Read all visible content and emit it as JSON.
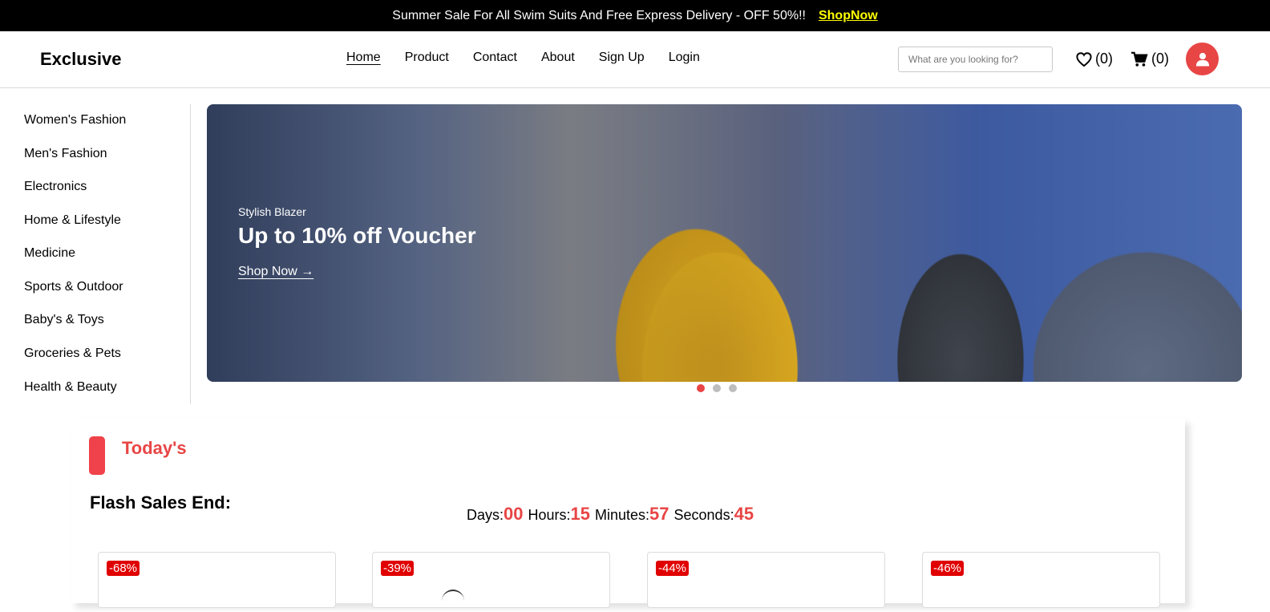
{
  "topbar": {
    "promo": "Summer Sale For All Swim Suits And Free Express Delivery - OFF 50%!!",
    "shop_now": "ShopNow"
  },
  "header": {
    "logo": "Exclusive",
    "nav": [
      "Home",
      "Product",
      "Contact",
      "About",
      "Sign Up",
      "Login"
    ],
    "active_nav": "Home",
    "search_placeholder": "What are you looking for?",
    "wishlist_count": "(0)",
    "cart_count": "(0)",
    "icons": {
      "wishlist": "heart-icon",
      "cart": "cart-icon",
      "account": "user-icon"
    },
    "accent_color": "#e84545"
  },
  "sidebar": {
    "categories": [
      "Women's Fashion",
      "Men's Fashion",
      "Electronics",
      "Home & Lifestyle",
      "Medicine",
      "Sports & Outdoor",
      "Baby's & Toys",
      "Groceries & Pets",
      "Health & Beauty"
    ]
  },
  "hero": {
    "subtitle": "Stylish Blazer",
    "headline": "Up to 10% off Voucher",
    "cta": "Shop Now →",
    "slide_count": 3,
    "active_slide": 1
  },
  "flash_sale": {
    "section_label": "Today's",
    "title": "Flash Sales End:",
    "countdown": {
      "days_label": "Days:",
      "days": "00",
      "hours_label": "Hours:",
      "hours": "15",
      "minutes_label": "Minutes:",
      "minutes": "57",
      "seconds_label": "Seconds:",
      "seconds": "45"
    },
    "products": [
      {
        "discount": "-68%"
      },
      {
        "discount": "-39%"
      },
      {
        "discount": "-44%"
      },
      {
        "discount": "-46%"
      }
    ]
  }
}
